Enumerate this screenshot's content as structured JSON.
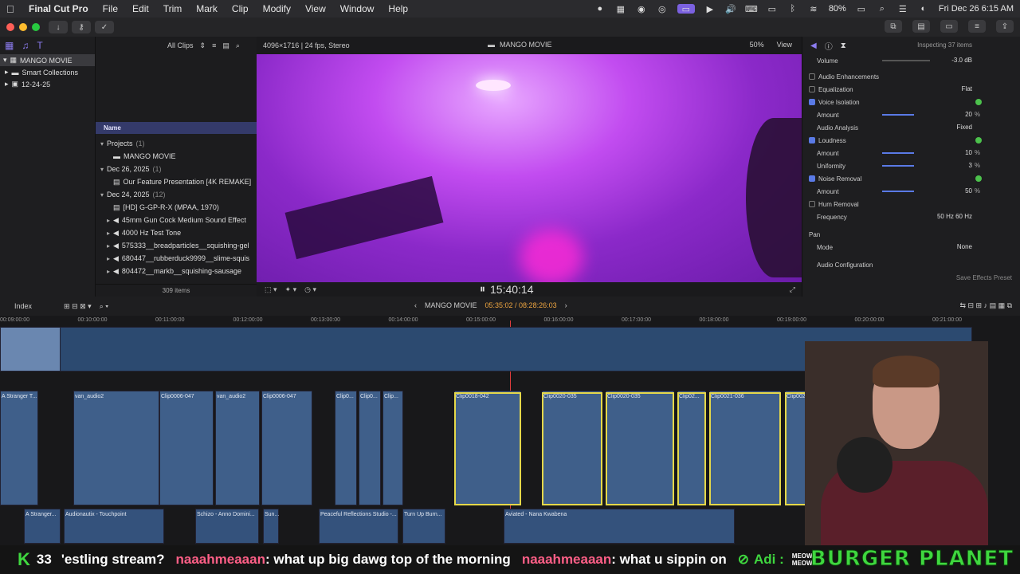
{
  "menubar": {
    "app": "Final Cut Pro",
    "items": [
      "File",
      "Edit",
      "Trim",
      "Mark",
      "Clip",
      "Modify",
      "View",
      "Window",
      "Help"
    ],
    "battery": "80%",
    "datetime": "Fri Dec 26  6:15 AM"
  },
  "library": {
    "name": "MANGO MOVIE",
    "items": [
      "Smart Collections",
      "12-24-25"
    ]
  },
  "browser": {
    "filter": "All Clips",
    "name_header": "Name",
    "rows": [
      {
        "label": "Projects",
        "count": "(1)"
      },
      {
        "label": "MANGO MOVIE",
        "count": ""
      },
      {
        "label": "Dec 26, 2025",
        "count": "(1)"
      },
      {
        "label": "Our Feature Presentation [4K REMAKE]",
        "count": ""
      },
      {
        "label": "Dec 24, 2025",
        "count": "(12)"
      },
      {
        "label": "[HD] G-GP-R-X (MPAA, 1970)",
        "count": ""
      },
      {
        "label": "45mm Gun Cock Medium Sound Effect",
        "count": ""
      },
      {
        "label": "4000 Hz Test Tone",
        "count": ""
      },
      {
        "label": "575333__breadparticles__squishing-gel",
        "count": ""
      },
      {
        "label": "680447__rubberduck9999__slime-squis",
        "count": ""
      },
      {
        "label": "804472__markb__squishing-sausage",
        "count": ""
      }
    ],
    "footer": "309 items"
  },
  "viewer": {
    "format": "4096×1716 | 24 fps, Stereo",
    "title": "MANGO MOVIE",
    "zoom": "50%",
    "view": "View",
    "timecode": "15:40:14"
  },
  "inspector": {
    "title": "Inspecting 37 items",
    "volume_label": "Volume",
    "volume_val": "-3.0 dB",
    "enh": "Audio Enhancements",
    "rows": [
      {
        "label": "Equalization",
        "val": "Flat",
        "unit": "",
        "cb": false,
        "indent": false
      },
      {
        "label": "Voice Isolation",
        "val": "",
        "unit": "",
        "cb": true,
        "indent": false
      },
      {
        "label": "Amount",
        "val": "20",
        "unit": "%",
        "cb": null,
        "indent": true
      },
      {
        "label": "Audio Analysis",
        "val": "Fixed",
        "unit": "",
        "cb": null,
        "indent": true
      },
      {
        "label": "Loudness",
        "val": "",
        "unit": "",
        "cb": true,
        "indent": false
      },
      {
        "label": "Amount",
        "val": "10",
        "unit": "%",
        "cb": null,
        "indent": true
      },
      {
        "label": "Uniformity",
        "val": "3",
        "unit": "%",
        "cb": null,
        "indent": true
      },
      {
        "label": "Noise Removal",
        "val": "",
        "unit": "",
        "cb": true,
        "indent": false
      },
      {
        "label": "Amount",
        "val": "50",
        "unit": "%",
        "cb": null,
        "indent": true
      },
      {
        "label": "Hum Removal",
        "val": "",
        "unit": "",
        "cb": false,
        "indent": false
      },
      {
        "label": "Frequency",
        "val": "50 Hz   60 Hz",
        "unit": "",
        "cb": null,
        "indent": true
      }
    ],
    "pan": "Pan",
    "mode_label": "Mode",
    "mode_val": "None",
    "config": "Audio Configuration",
    "save": "Save Effects Preset"
  },
  "timeline": {
    "index": "Index",
    "project": "MANGO MOVIE",
    "tc": "05:35:02 / 08:28:26:03",
    "ruler": [
      "00:09:00:00",
      "00:10:00:00",
      "00:11:00:00",
      "00:12:00:00",
      "00:13:00:00",
      "00:14:00:00",
      "00:15:00:00",
      "00:16:00:00",
      "00:17:00:00",
      "00:18:00:00",
      "00:19:00:00",
      "00:20:00:00",
      "00:21:00:00"
    ],
    "clips": [
      "A Stranger T...",
      "van_audio2",
      "Clip0006-047",
      "van_audio2",
      "Clip0006-047",
      "Clip0...",
      "Clip0...",
      "Clip...",
      "Clip0018-042",
      "Clip0020-035",
      "Clip0020-035",
      "Clip02...",
      "Clip0021-036",
      "Clip0022-0..."
    ],
    "music": [
      "A Stranger...",
      "Audionautix - Touchpoint",
      "Schizo - Anno Domini...",
      "Sun...",
      "Peaceful Reflections Studio -...",
      "Turn Up Burn...",
      "Aviated - Nana Kwabena"
    ]
  },
  "chat": {
    "count": "33",
    "fragment": "'estling stream?",
    "user1": "naaahmeaaan",
    "msg1": ": what up big dawg top of the morning",
    "user2": "naaahmeaaan",
    "msg2": ": what u sippin on",
    "user3": "Adi :",
    "meow": "MEOW MEOW",
    "brand": "BURGER PLANET"
  }
}
